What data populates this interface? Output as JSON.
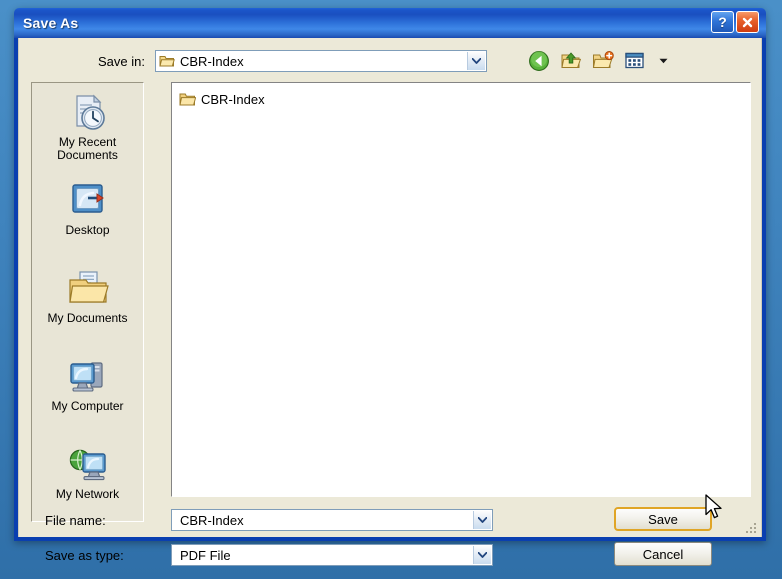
{
  "window": {
    "title": "Save As",
    "help_button": "?",
    "close_button": "✕"
  },
  "toolbar": {
    "save_in_label": "Save in:",
    "current_folder": "CBR-Index",
    "buttons": [
      {
        "name": "back-icon",
        "tooltip": "Back"
      },
      {
        "name": "up-one-level-icon",
        "tooltip": "Up One Level"
      },
      {
        "name": "new-folder-icon",
        "tooltip": "Create New Folder"
      },
      {
        "name": "views-icon",
        "tooltip": "Views"
      }
    ]
  },
  "places": {
    "items": [
      {
        "label": "My Recent Documents",
        "icon": "recent-documents-icon"
      },
      {
        "label": "Desktop",
        "icon": "desktop-icon"
      },
      {
        "label": "My Documents",
        "icon": "my-documents-icon"
      },
      {
        "label": "My Computer",
        "icon": "my-computer-icon"
      },
      {
        "label": "My Network",
        "icon": "my-network-icon"
      }
    ]
  },
  "file_list": {
    "items": [
      {
        "name": "CBR-Index",
        "type": "folder"
      }
    ]
  },
  "form": {
    "file_name_label": "File name:",
    "file_name_value": "CBR-Index",
    "save_as_type_label": "Save as type:",
    "save_as_type_value": "PDF File"
  },
  "buttons": {
    "save": "Save",
    "cancel": "Cancel"
  },
  "colors": {
    "title_bar_blue": "#1f63d8",
    "frame_blue": "#0a3fb0",
    "dialog_face": "#ece9d8",
    "default_button_highlight": "#e0a526",
    "desktop_blue": "#3f83bd"
  }
}
